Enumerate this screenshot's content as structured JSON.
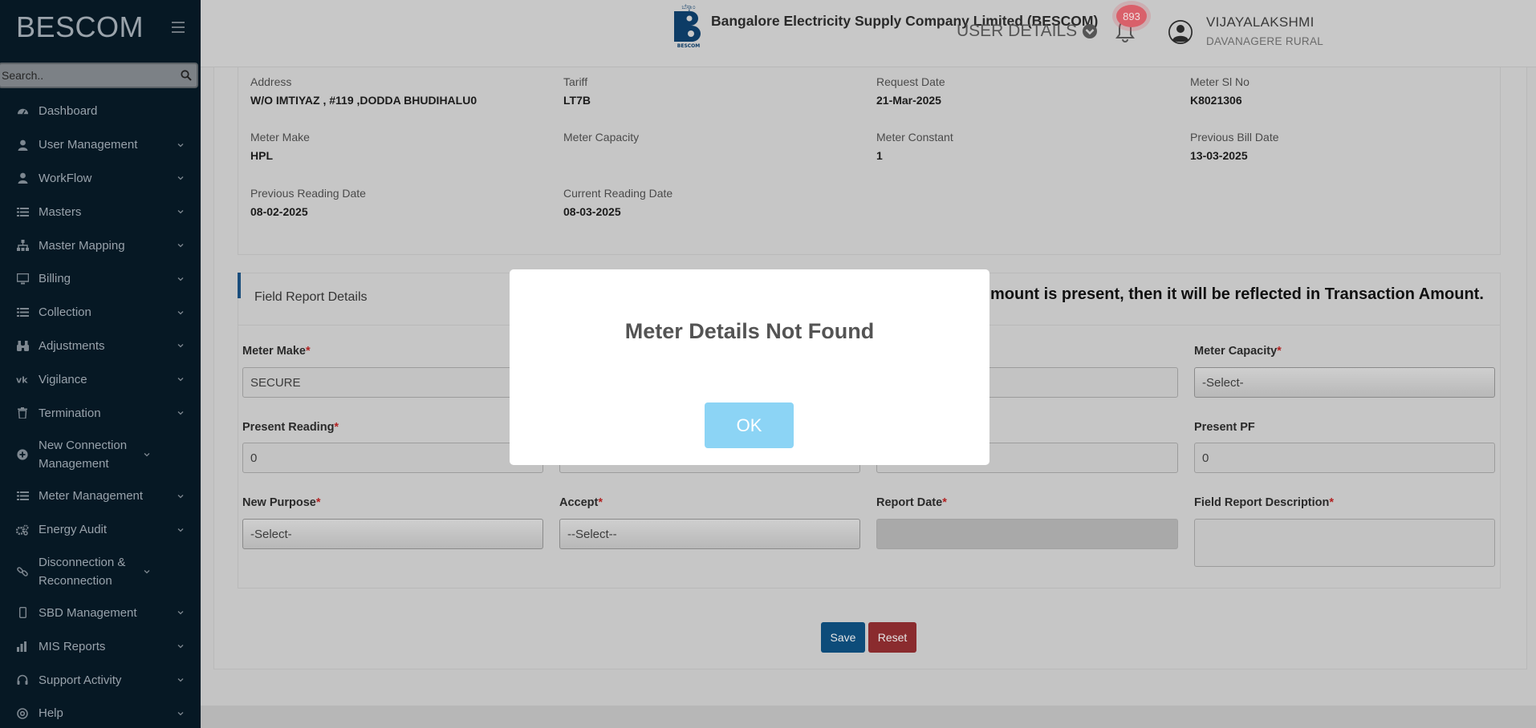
{
  "sidebar": {
    "brand": "BESCOM",
    "search_placeholder": "Search..",
    "items": [
      {
        "label": "Dashboard",
        "icon": "dashboard-icon",
        "has_children": false
      },
      {
        "label": "User Management",
        "icon": "user-icon",
        "has_children": true
      },
      {
        "label": "WorkFlow",
        "icon": "user-icon",
        "has_children": true
      },
      {
        "label": "Masters",
        "icon": "list-icon",
        "has_children": true
      },
      {
        "label": "Master Mapping",
        "icon": "sitemap-icon",
        "has_children": true
      },
      {
        "label": "Billing",
        "icon": "monitor-icon",
        "has_children": true
      },
      {
        "label": "Collection",
        "icon": "list-icon",
        "has_children": true
      },
      {
        "label": "Adjustments",
        "icon": "binoculars-icon",
        "has_children": true
      },
      {
        "label": "Vigilance",
        "icon": "vk-icon",
        "has_children": true
      },
      {
        "label": "Termination",
        "icon": "trash-icon",
        "has_children": true
      },
      {
        "label": "New Connection Management",
        "icon": "plus-circle-icon",
        "has_children": true
      },
      {
        "label": "Meter Management",
        "icon": "list-icon",
        "has_children": true
      },
      {
        "label": "Energy Audit",
        "icon": "gears-icon",
        "has_children": true
      },
      {
        "label": "Disconnection & Reconnection",
        "icon": "link-icon",
        "has_children": true
      },
      {
        "label": "SBD Management",
        "icon": "mobile-icon",
        "has_children": true
      },
      {
        "label": "MIS Reports",
        "icon": "bar-chart-icon",
        "has_children": true
      },
      {
        "label": "Support Activity",
        "icon": "headset-icon",
        "has_children": true
      },
      {
        "label": "Help",
        "icon": "help-icon",
        "has_children": true
      }
    ]
  },
  "header": {
    "company": "Bangalore Electricity Supply Company Limited (BESCOM)",
    "user_details_label": "USER DETAILS",
    "notification_count": "893",
    "username": "VIJAYALAKSHMI",
    "location": "DAVANAGERE RURAL"
  },
  "consumer_info": {
    "fields": [
      {
        "label": "Address",
        "value": "W/O IMTIYAZ , #119 ,DODDA BHUDIHALU0"
      },
      {
        "label": "Tariff",
        "value": "LT7B"
      },
      {
        "label": "Request Date",
        "value": "21-Mar-2025"
      },
      {
        "label": "Meter Sl No",
        "value": "K8021306"
      },
      {
        "label": "Meter Make",
        "value": "HPL"
      },
      {
        "label": "Meter Capacity",
        "value": ""
      },
      {
        "label": "Meter Constant",
        "value": "1"
      },
      {
        "label": "Previous Bill Date",
        "value": "13-03-2025"
      },
      {
        "label": "Previous Reading Date",
        "value": "08-02-2025"
      },
      {
        "label": "Current Reading Date",
        "value": "08-03-2025"
      }
    ]
  },
  "field_report": {
    "title": "Field Report Details",
    "notice": "mount is present, then it will be reflected in Transaction Amount.",
    "meter_make": {
      "label": "Meter Make",
      "value": "SECURE"
    },
    "meter_capacity": {
      "label": "Meter Capacity",
      "value": "-Select-"
    },
    "present_reading": {
      "label": "Present Reading",
      "value": "0"
    },
    "present_pf": {
      "label": "Present PF",
      "value": "0"
    },
    "new_purpose": {
      "label": "New Purpose",
      "value": "-Select-"
    },
    "accept": {
      "label": "Accept",
      "value": "--Select--"
    },
    "report_date": {
      "label": "Report Date",
      "value": ""
    },
    "description": {
      "label": "Field Report Description",
      "value": ""
    },
    "required_mark": "*",
    "save_label": "Save",
    "reset_label": "Reset"
  },
  "modal": {
    "title": "Meter Details Not Found",
    "ok_label": "OK"
  },
  "colors": {
    "sidebar_bg": "#061824",
    "modal_ok": "#8cd4f5",
    "badge": "#d9606a",
    "save": "#0d4c7a",
    "reset": "#8a2b2e"
  }
}
